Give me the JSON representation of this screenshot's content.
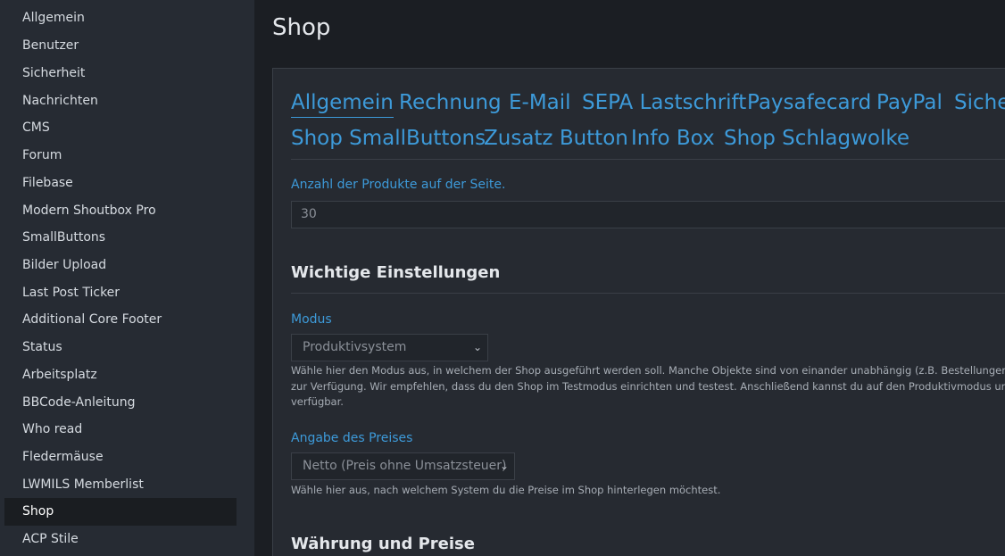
{
  "sidebar": {
    "items": [
      {
        "label": "Allgemein"
      },
      {
        "label": "Benutzer"
      },
      {
        "label": "Sicherheit"
      },
      {
        "label": "Nachrichten"
      },
      {
        "label": "CMS"
      },
      {
        "label": "Forum"
      },
      {
        "label": "Filebase"
      },
      {
        "label": "Modern Shoutbox Pro"
      },
      {
        "label": "SmallButtons"
      },
      {
        "label": "Bilder Upload"
      },
      {
        "label": "Last Post Ticker"
      },
      {
        "label": "Additional Core Footer"
      },
      {
        "label": "Status"
      },
      {
        "label": "Arbeitsplatz"
      },
      {
        "label": "BBCode-Anleitung"
      },
      {
        "label": "Who read"
      },
      {
        "label": "Fledermäuse"
      },
      {
        "label": "LWMILS Memberlist"
      },
      {
        "label": "Shop"
      },
      {
        "label": "ACP Stile"
      }
    ],
    "active": "Shop"
  },
  "main": {
    "title": "Shop",
    "tabs": [
      {
        "label": "Allgemein"
      },
      {
        "label": "Rechnung"
      },
      {
        "label": "E-Mail"
      },
      {
        "label": "SEPA Lastschrift"
      },
      {
        "label": "Paysafecard"
      },
      {
        "label": "PayPal"
      },
      {
        "label": "Sicher"
      },
      {
        "label": "Shop SmallButtons"
      },
      {
        "label": "Zusatz Button"
      },
      {
        "label": "Info Box"
      },
      {
        "label": "Shop Schlagwolke"
      }
    ],
    "products_per_page": {
      "label": "Anzahl der Produkte auf der Seite.",
      "value": "30"
    },
    "section_important": {
      "title": "Wichtige Einstellungen"
    },
    "mode": {
      "label": "Modus",
      "selected": "Produktivsystem",
      "desc_lines": [
        "Wähle hier den Modus aus, in welchem der Shop ausgeführt werden soll. Manche Objekte sind von einander unabhängig (z.B. Bestellungen), d.h",
        "zur Verfügung. Wir empfehlen, dass du den Shop im Testmodus einrichten und testest. Anschließend kannst du auf den Produktivmodus umsch",
        "verfügbar."
      ]
    },
    "price": {
      "label": "Angabe des Preises",
      "selected": "Netto (Preis ohne Umsatzsteuer)",
      "desc": "Wähle hier aus, nach welchem System du die Preise im Shop hinterlegen möchtest."
    },
    "section_currency": {
      "title": "Währung und Preise"
    }
  },
  "icons": {
    "select_chevron": "chevron-down-icon"
  },
  "colors": {
    "accent": "#3d9ad9",
    "sidebar_bg": "#262b33",
    "main_bg": "#1b1e23",
    "panel_bg": "#262a31"
  }
}
